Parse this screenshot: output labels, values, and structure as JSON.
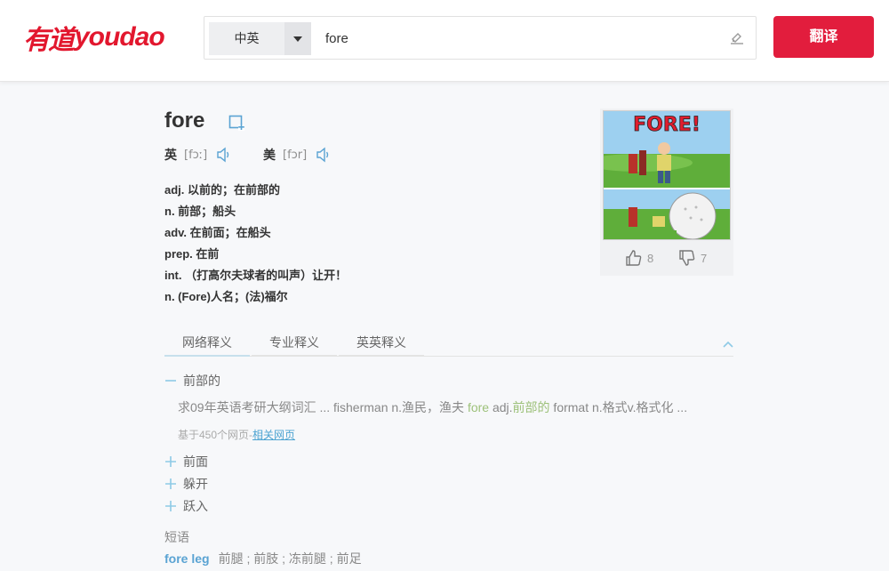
{
  "header": {
    "logo_cn": "有道",
    "logo_en": "youdao",
    "lang_select": "中英",
    "search_value": "fore",
    "translate_button": "翻译"
  },
  "word": {
    "headword": "fore",
    "uk_label": "英",
    "uk_ipa": "[fɔː]",
    "us_label": "美",
    "us_ipa": "[fɔr]"
  },
  "definitions": [
    "adj. 以前的；在前部的",
    "n. 前部；船头",
    "adv. 在前面；在船头",
    "prep. 在前",
    "int. （打高尔夫球者的叫声）让开！",
    "n. (Fore)人名；(法)福尔"
  ],
  "picture": {
    "likes": "8",
    "dislikes": "7",
    "cartoon_text": "FORE!"
  },
  "tabs": [
    "网络释义",
    "专业释义",
    "英英释义"
  ],
  "web_senses": {
    "expanded": {
      "label": "前部的",
      "excerpt_before": "求09年英语考研大纲词汇 ... fisherman n.渔民，渔夫 ",
      "excerpt_word": "fore",
      "excerpt_mid": " adj.",
      "excerpt_def": "前部的",
      "excerpt_after": " format n.格式v.格式化 ...",
      "source_text": "基于450个网页-",
      "source_link": "相关网页"
    },
    "collapsed": [
      "前面",
      "躲开",
      "跃入"
    ]
  },
  "phrases": {
    "title": "短语",
    "items": [
      {
        "word": "fore leg",
        "meaning": "前腿 ; 前肢 ; 冻前腿 ; 前足"
      }
    ]
  },
  "colors": {
    "brand": "#e2172e",
    "button": "#e21d3d",
    "link": "#4ca3d1",
    "highlight": "#9dc17a"
  }
}
